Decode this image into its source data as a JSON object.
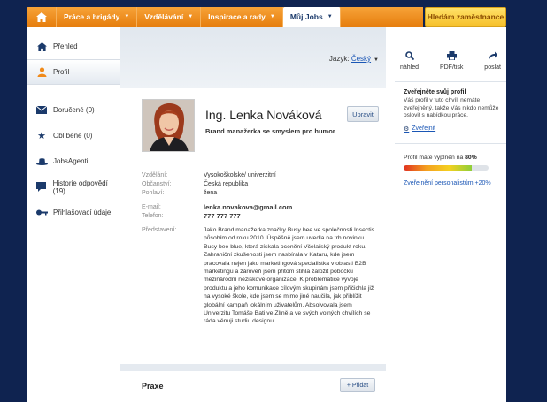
{
  "nav": {
    "items": [
      {
        "label": "Práce a brigády"
      },
      {
        "label": "Vzdělávání"
      },
      {
        "label": "Inspirace a rady"
      },
      {
        "label": "Můj Jobs"
      }
    ],
    "employer_label": "Hledám zaměstnance"
  },
  "sidebar": {
    "items": [
      {
        "label": "Přehled",
        "icon": "home-icon"
      },
      {
        "label": "Profil",
        "icon": "user-icon"
      },
      {
        "label": "Doručené (0)",
        "icon": "mail-icon"
      },
      {
        "label": "Oblíbené (0)",
        "icon": "star-icon"
      },
      {
        "label": "JobsAgenti",
        "icon": "hat-icon"
      },
      {
        "label": "Historie odpovědí (19)",
        "icon": "speech-icon"
      },
      {
        "label": "Přihlašovací údaje",
        "icon": "key-icon"
      }
    ]
  },
  "lang": {
    "label": "Jazyk:",
    "value": "Český"
  },
  "profile": {
    "name": "Ing. Lenka Nováková",
    "headline": "Brand manažerka se smyslem pro humor",
    "edit_label": "Upravit",
    "fields": {
      "education": {
        "label": "Vzdělání:",
        "value": "Vysokoškolské/ univerzitní"
      },
      "citizenship": {
        "label": "Občanství:",
        "value": "Česká republika"
      },
      "gender": {
        "label": "Pohlaví:",
        "value": "žena"
      },
      "email": {
        "label": "E-mail:",
        "value": "lenka.novakova@gmail.com"
      },
      "phone": {
        "label": "Telefon:",
        "value": "777 777 777"
      },
      "intro": {
        "label": "Představení:",
        "value": "Jako Brand manažerka značky Busy bee ve společnosti Insectis působím od roku 2010. Úspěšně jsem uvedla na trh novinku Busy bee blue, která získala ocenění Včelařský produkt roku. Zahraniční zkušenosti jsem nasbírala v Kataru, kde jsem pracovala nejen jako marketingová specialistka v oblasti B2B marketingu a zároveň jsem přitom stihla založit pobočku mezinárodní neziskové organizace. K problematice vývoje produktu a jeho komunikace cílovým skupinám jsem přičichla již na vysoké škole, kde jsem se mimo jiné naučila, jak přiblížit globální kampaň lokálním uživatelům. Absolvovala jsem Univerzitu Tomáše Bati ve Zlíně a ve svých volných chvílích se ráda věnuji studiu designu."
      }
    }
  },
  "praxe": {
    "title": "Praxe",
    "add_label": "+ Přidat"
  },
  "tools": [
    {
      "label": "náhled",
      "icon": "magnifier-icon"
    },
    {
      "label": "PDF/tisk",
      "icon": "printer-icon"
    },
    {
      "label": "poslat",
      "icon": "send-icon"
    }
  ],
  "publish": {
    "title": "Zveřejněte svůj profil",
    "text": "Váš profil v tuto chvíli nemáte zveřejněný, takže Vás nikdo nemůže oslovit s nabídkou práce.",
    "link": "Zveřejnit"
  },
  "completion": {
    "text_prefix": "Profil máte vyplněn na",
    "percent_label": "80%",
    "progress": 0.8,
    "link": "Zveřejnění personalistům +20%"
  }
}
